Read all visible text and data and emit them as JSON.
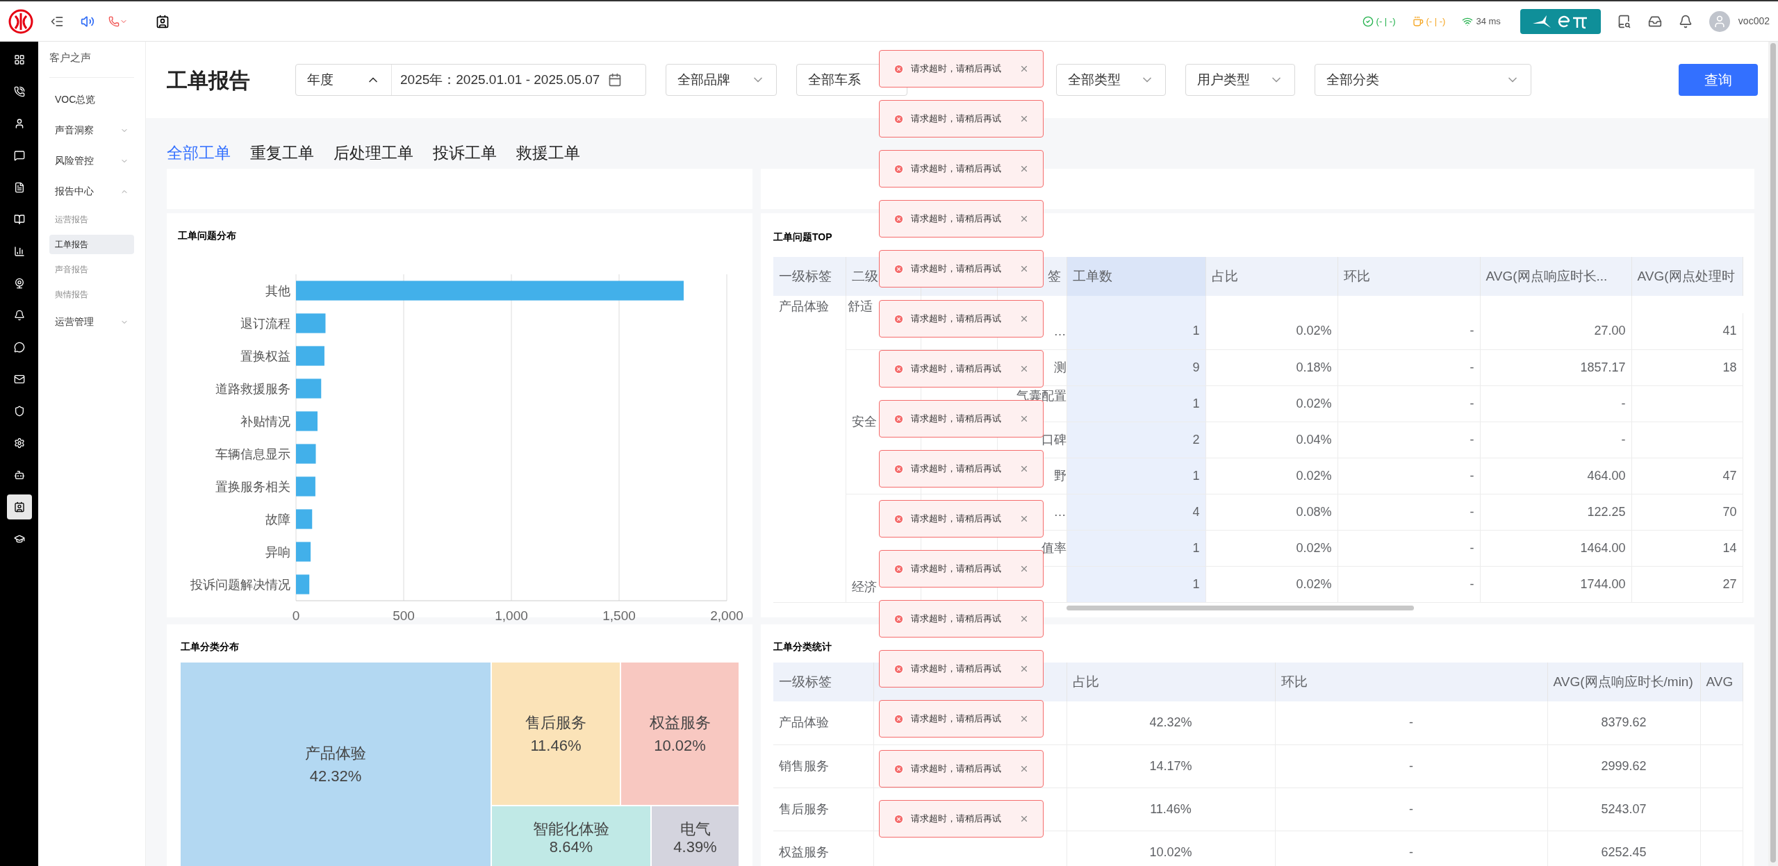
{
  "topbar": {
    "status_ok": "(- | -)",
    "status_cup": "(- | -)",
    "latency": "34 ms",
    "user": "voc002"
  },
  "rail": [
    {
      "selected": false
    },
    {
      "selected": false
    },
    {
      "selected": false
    },
    {
      "selected": false
    },
    {
      "selected": false
    },
    {
      "selected": false
    },
    {
      "selected": false
    },
    {
      "selected": false
    },
    {
      "selected": false
    },
    {
      "selected": false
    },
    {
      "selected": false
    },
    {
      "selected": false
    },
    {
      "selected": false
    },
    {
      "selected": false
    },
    {
      "selected": true
    },
    {
      "selected": false
    }
  ],
  "sidebar": {
    "title": "客户之声",
    "items": [
      {
        "label": "VOC总览",
        "kind": "link"
      },
      {
        "label": "声音洞察",
        "kind": "group",
        "expanded": false
      },
      {
        "label": "风险管控",
        "kind": "group",
        "expanded": false
      },
      {
        "label": "报告中心",
        "kind": "group",
        "expanded": true,
        "children": [
          {
            "label": "运营报告",
            "selected": false
          },
          {
            "label": "工单报告",
            "selected": true
          },
          {
            "label": "声音报告",
            "selected": false
          },
          {
            "label": "舆情报告",
            "selected": false
          }
        ]
      },
      {
        "label": "运营管理",
        "kind": "group",
        "expanded": false
      }
    ]
  },
  "page_title": "工单报告",
  "filters": {
    "period": "年度",
    "period_open": true,
    "date_range": "2025年：2025.01.01 - 2025.05.07",
    "brand": "全部品牌",
    "series": "全部车系",
    "type": "全部类型",
    "user_type": "用户类型",
    "category": "全部分类",
    "query_button": "查询"
  },
  "tabs": [
    {
      "label": "全部工单",
      "selected": true
    },
    {
      "label": "重复工单",
      "selected": false
    },
    {
      "label": "后处理工单",
      "selected": false
    },
    {
      "label": "投诉工单",
      "selected": false
    },
    {
      "label": "救援工单",
      "selected": false
    }
  ],
  "issue_distribution": {
    "title": "工单问题分布",
    "chart_data": {
      "type": "bar",
      "orientation": "horizontal",
      "categories": [
        "其他",
        "退订流程",
        "置换权益",
        "道路救援服务",
        "补贴情况",
        "车辆信息显示",
        "置换服务相关",
        "故障",
        "异响",
        "投诉问题解决情况"
      ],
      "grid": true,
      "series": [
        {
          "color": "#42b0ea",
          "values": [
            1800,
            137,
            132,
            117,
            100,
            92,
            90,
            75,
            68,
            62
          ]
        }
      ],
      "xlim": [
        0,
        2000
      ],
      "xticks": [
        {
          "value": 0,
          "label": "0"
        },
        {
          "value": 500,
          "label": "500"
        },
        {
          "value": 1000,
          "label": "1,000"
        },
        {
          "value": 1500,
          "label": "1,500"
        },
        {
          "value": 2000,
          "label": "2,000"
        }
      ]
    }
  },
  "issue_top": {
    "title": "工单问题TOP",
    "columns": [
      "一级标签",
      "二级",
      "签",
      "工单数",
      "占比",
      "环比",
      "AVG(网点响应时长...",
      "AVG(网点处理时"
    ],
    "level1": "产品体验",
    "groups": [
      {
        "label": "舒适",
        "rows": [
          {
            "level4": "…",
            "count": "1",
            "share": "0.02%",
            "mom": "-",
            "avg_response": "27.00",
            "avg_process": "41"
          }
        ]
      },
      {
        "label": "安全",
        "rows": [
          {
            "level4": "测",
            "count": "9",
            "share": "0.18%",
            "mom": "-",
            "avg_response": "1857.17",
            "avg_process": "18"
          },
          {
            "level4": "气囊配置",
            "count": "1",
            "share": "0.02%",
            "mom": "-",
            "avg_response": "-",
            "avg_process": ""
          },
          {
            "level4": "口碑",
            "count": "2",
            "share": "0.04%",
            "mom": "-",
            "avg_response": "-",
            "avg_process": ""
          },
          {
            "level4": "野",
            "count": "1",
            "share": "0.02%",
            "mom": "-",
            "avg_response": "464.00",
            "avg_process": "47"
          }
        ]
      },
      {
        "label": "经济",
        "rows": [
          {
            "level4": "…",
            "count": "4",
            "share": "0.08%",
            "mom": "-",
            "avg_response": "122.25",
            "avg_process": "70"
          },
          {
            "level4": "值率",
            "count": "1",
            "share": "0.02%",
            "mom": "-",
            "avg_response": "1464.00",
            "avg_process": "14"
          },
          {
            "level4": "",
            "count": "1",
            "share": "0.02%",
            "mom": "-",
            "avg_response": "1744.00",
            "avg_process": "27"
          }
        ]
      }
    ]
  },
  "category_distribution": {
    "title": "工单分类分布",
    "items": [
      {
        "label": "产品体验",
        "share": "42.32%",
        "color": "#b3d8f2"
      },
      {
        "label": "售后服务",
        "share": "11.46%",
        "color": "#fbe3b8"
      },
      {
        "label": "权益服务",
        "share": "10.02%",
        "color": "#f8c8c1"
      },
      {
        "label": "智能化体验",
        "share": "8.64%",
        "color": "#c0e9e6"
      },
      {
        "label": "电气",
        "share": "4.39%",
        "color": "#d4d4de"
      }
    ]
  },
  "category_stats": {
    "title": "工单分类统计",
    "columns": [
      "一级标签",
      "占比",
      "环比",
      "AVG(网点响应时长/min)",
      "AVG"
    ],
    "rows": [
      {
        "label": "产品体验",
        "share": "42.32%",
        "mom": "-",
        "avg_response": "8379.62"
      },
      {
        "label": "销售服务",
        "share": "14.17%",
        "mom": "-",
        "avg_response": "2999.62"
      },
      {
        "label": "售后服务",
        "share": "11.46%",
        "mom": "-",
        "avg_response": "5243.07"
      },
      {
        "label": "权益服务",
        "share": "10.02%",
        "mom": "-",
        "avg_response": "6252.45"
      }
    ]
  },
  "toasts": [
    {
      "message": "请求超时，请稍后再试"
    },
    {
      "message": "请求超时，请稍后再试"
    },
    {
      "message": "请求超时，请稍后再试"
    },
    {
      "message": "请求超时，请稍后再试"
    },
    {
      "message": "请求超时，请稍后再试"
    },
    {
      "message": "请求超时，请稍后再试"
    },
    {
      "message": "请求超时，请稍后再试"
    },
    {
      "message": "请求超时，请稍后再试"
    },
    {
      "message": "请求超时，请稍后再试"
    },
    {
      "message": "请求超时，请稍后再试"
    },
    {
      "message": "请求超时，请稍后再试"
    },
    {
      "message": "请求超时，请稍后再试"
    },
    {
      "message": "请求超时，请稍后再试"
    },
    {
      "message": "请求超时，请稍后再试"
    },
    {
      "message": "请求超时，请稍后再试"
    },
    {
      "message": "请求超时，请稍后再试"
    }
  ]
}
